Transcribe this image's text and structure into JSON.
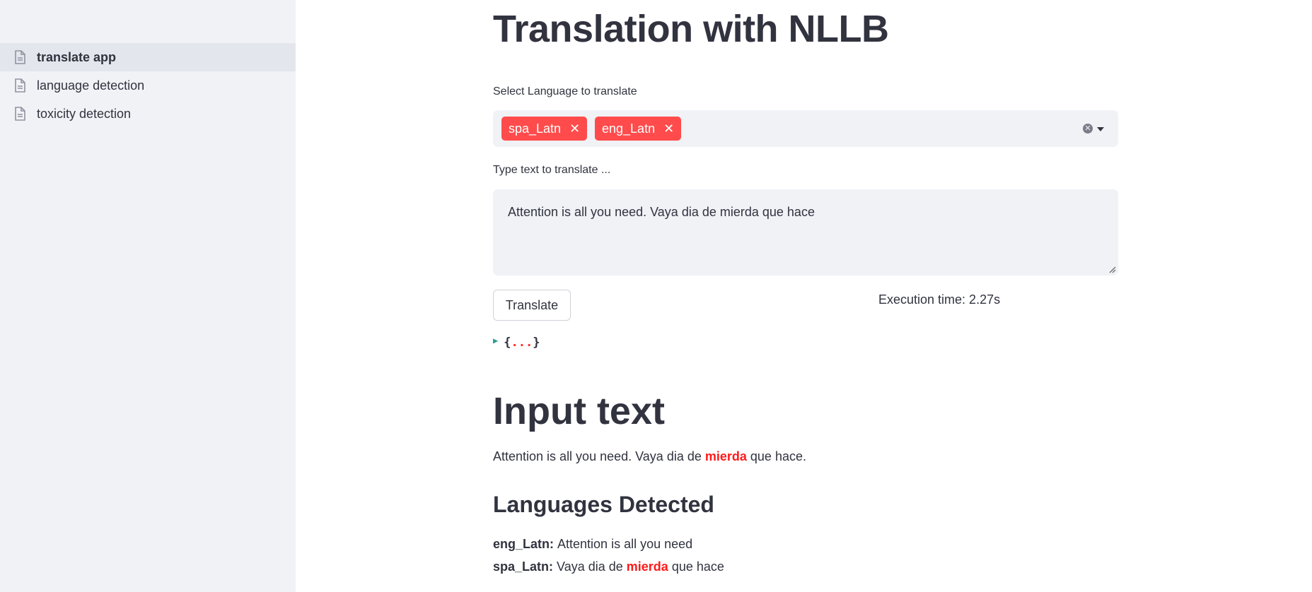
{
  "sidebar": {
    "items": [
      {
        "label": "translate app",
        "active": true,
        "icon": "document-icon"
      },
      {
        "label": "language detection",
        "active": false,
        "icon": "document-icon"
      },
      {
        "label": "toxicity detection",
        "active": false,
        "icon": "document-icon"
      }
    ]
  },
  "main": {
    "title": "Translation with NLLB",
    "select_label": "Select Language to translate",
    "selected_languages": [
      "spa_Latn",
      "eng_Latn"
    ],
    "tag_remove_symbol": "✕",
    "clear_symbol": "✕",
    "textarea_label": "Type text to translate ...",
    "textarea_value": "Attention is all you need. Vaya dia de mierda que hace",
    "translate_button": "Translate",
    "execution_time": "Execution time: 2.27s",
    "json_open": "{",
    "json_dots": "...",
    "json_close": "}",
    "input_heading": "Input text",
    "input_text": {
      "before": "Attention is all you need. Vaya dia de ",
      "highlight": "mierda",
      "after": " que hace."
    },
    "languages_heading": "Languages Detected",
    "detected": [
      {
        "code": "eng_Latn",
        "sep": ": ",
        "before": "Attention is all you need",
        "highlight": "",
        "after": ""
      },
      {
        "code": "spa_Latn",
        "sep": ": ",
        "before": "Vaya dia de ",
        "highlight": "mierda",
        "after": " que hace"
      }
    ]
  },
  "colors": {
    "accent": "#ff4b4b",
    "toxic_highlight": "#ff1a1a",
    "sidebar_bg": "#f0f2f6",
    "text": "#31333f"
  }
}
